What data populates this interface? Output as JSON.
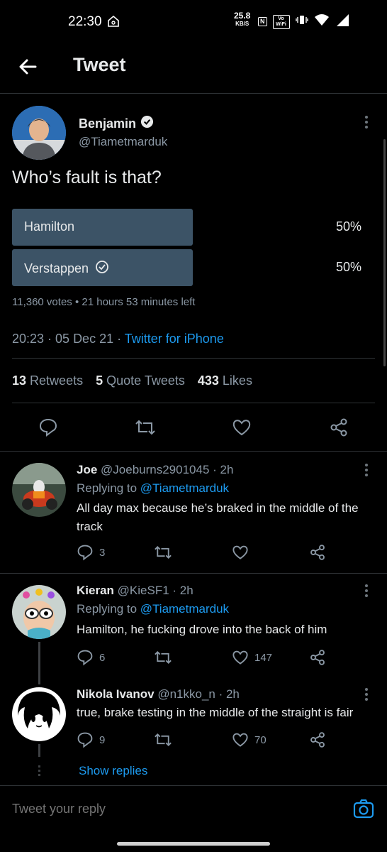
{
  "status_bar": {
    "time": "22:30",
    "net_speed": "25.8",
    "net_unit": "KB/S",
    "nfc": "N",
    "vowifi": "Vo WiFi"
  },
  "header": {
    "title": "Tweet"
  },
  "tweet": {
    "author_name": "Benjamin",
    "author_handle": "@Tiametmarduk",
    "text": "Who’s fault is that?",
    "poll": {
      "options": [
        {
          "label": "Hamilton",
          "percent": "50%",
          "fill": 0.5,
          "selected": false
        },
        {
          "label": "Verstappen",
          "percent": "50%",
          "fill": 0.5,
          "selected": true
        }
      ],
      "meta": "11,360 votes • 21 hours 53 minutes left"
    },
    "time": "20:23 · 05 Dec 21 · ",
    "source": "Twitter for iPhone",
    "stats": {
      "retweets_count": "13",
      "retweets_label": "Retweets",
      "quotes_count": "5",
      "quotes_label": "Quote Tweets",
      "likes_count": "433",
      "likes_label": "Likes"
    }
  },
  "replies": [
    {
      "name": "Joe",
      "handle": "@Joeburns2901045 · 2h",
      "replying_prefix": "Replying to ",
      "mention": "@Tiametmarduk",
      "text": "All day max because he’s braked in the middle of the track",
      "replies": "3",
      "retweets": "",
      "likes": ""
    },
    {
      "name": "Kieran",
      "handle": "@KieSF1 · 2h",
      "replying_prefix": "Replying to ",
      "mention": "@Tiametmarduk",
      "text": "Hamilton, he fucking drove into the back of him",
      "replies": "6",
      "retweets": "",
      "likes": "147"
    },
    {
      "name": "Nikola Ivanov",
      "handle": "@n1kko_n · 2h",
      "text": "true, brake testing in the middle of the straight is fair",
      "replies": "9",
      "retweets": "",
      "likes": "70"
    }
  ],
  "show_replies": "Show replies",
  "composer": {
    "placeholder": "Tweet your reply"
  },
  "colors": {
    "accent": "#1d9bf0",
    "poll_bar": "#3c5366",
    "background": "#000000"
  }
}
